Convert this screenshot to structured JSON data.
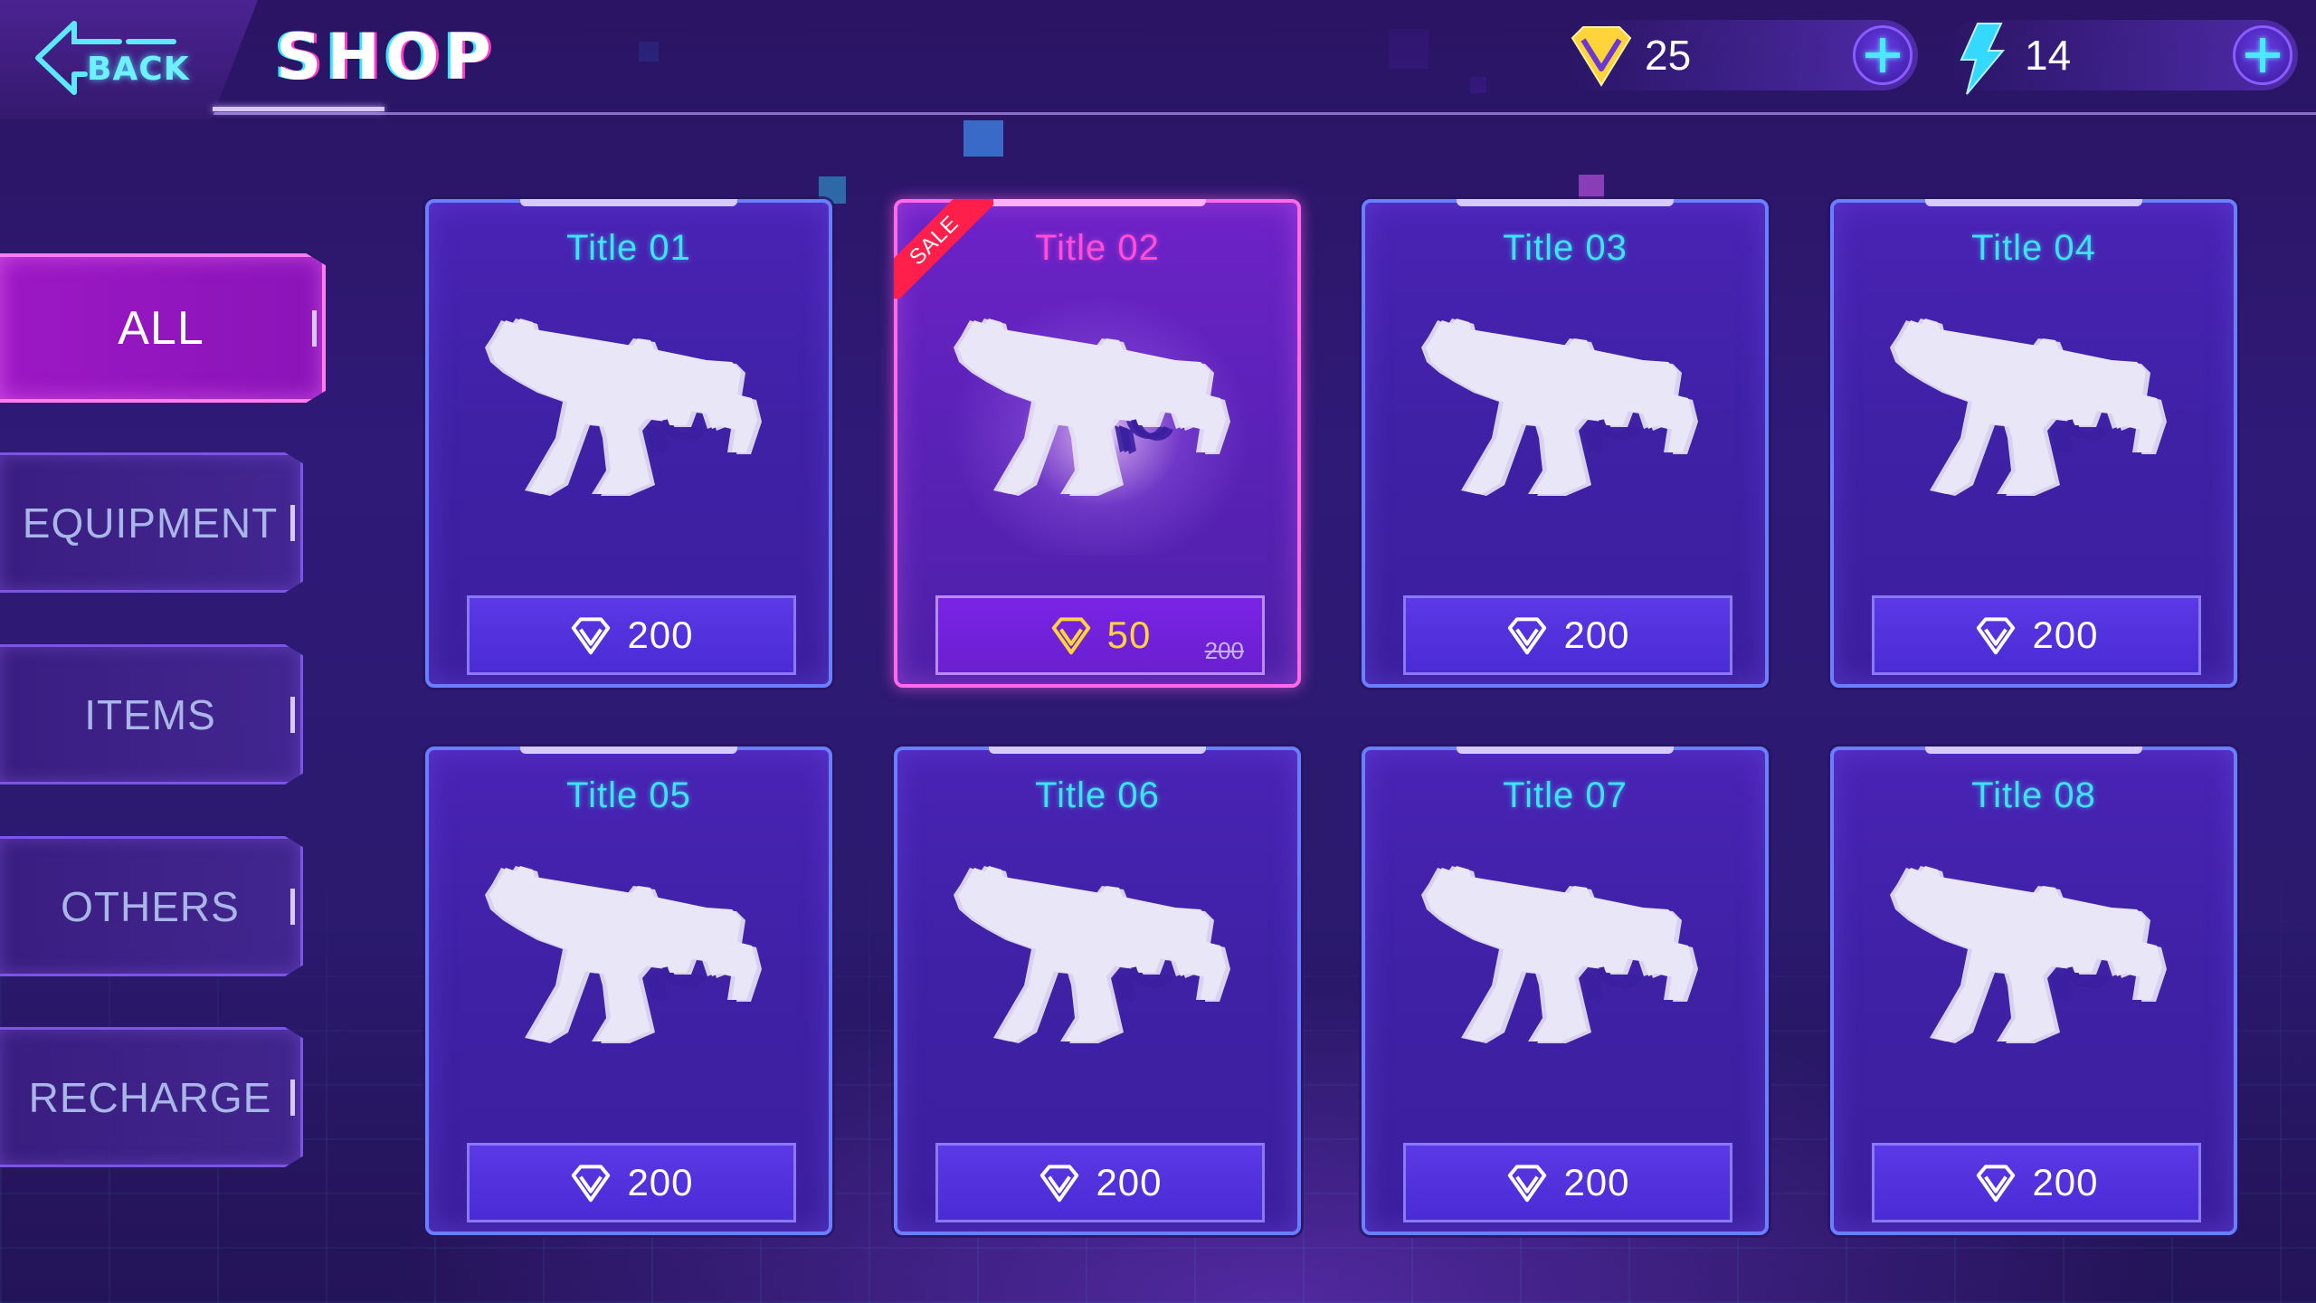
{
  "header": {
    "back_label": "BACK",
    "title": "SHOP"
  },
  "currencies": [
    {
      "name": "gems",
      "icon": "gem-icon",
      "value": "25",
      "color": "#ffd43a"
    },
    {
      "name": "energy",
      "icon": "lightning-icon",
      "value": "14",
      "color": "#35d8ff"
    }
  ],
  "sidebar": {
    "items": [
      {
        "label": "ALL",
        "active": true
      },
      {
        "label": "EQUIPMENT",
        "active": false
      },
      {
        "label": "ITEMS",
        "active": false
      },
      {
        "label": "OTHERS",
        "active": false
      },
      {
        "label": "RECHARGE",
        "active": false
      }
    ]
  },
  "items": [
    {
      "title": "Title 01",
      "price": "200",
      "icon": "smg-icon",
      "sale": false
    },
    {
      "title": "Title 02",
      "price": "50",
      "old_price": "200",
      "sale": true,
      "sale_label": "SALE",
      "icon": "smg-icon"
    },
    {
      "title": "Title 03",
      "price": "200",
      "icon": "smg-icon",
      "sale": false
    },
    {
      "title": "Title 04",
      "price": "200",
      "icon": "smg-icon",
      "sale": false
    },
    {
      "title": "Title 05",
      "price": "200",
      "icon": "smg-icon",
      "sale": false
    },
    {
      "title": "Title 06",
      "price": "200",
      "icon": "smg-icon",
      "sale": false
    },
    {
      "title": "Title 07",
      "price": "200",
      "icon": "smg-icon",
      "sale": false
    },
    {
      "title": "Title 08",
      "price": "200",
      "icon": "smg-icon",
      "sale": false
    }
  ],
  "colors": {
    "accent_cyan": "#3fe3ff",
    "accent_pink": "#ff4fd8",
    "sale_red": "#ff1f4a",
    "gold": "#ffd43a"
  }
}
